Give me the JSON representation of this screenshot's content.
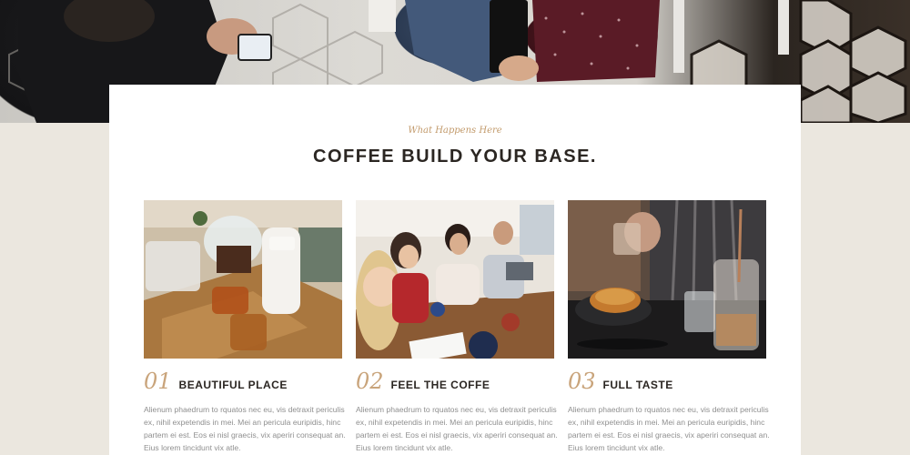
{
  "hero": {
    "image_icon": "cafe-people-photo"
  },
  "section": {
    "eyebrow": "What Happens Here",
    "title": "COFFEE BUILD YOUR BASE."
  },
  "features": [
    {
      "number": "01",
      "title": "BEAUTIFUL PLACE",
      "description": "Alienum phaedrum to rquatos nec eu, vis detraxit periculis ex, nihil expetendis in mei. Mei an pericula euripidis, hinc partem ei est. Eos ei nisl graecis, vix aperiri consequat an. Eius lorem tincidunt vix atle.",
      "image_icon": "coffee-brewing-photo"
    },
    {
      "number": "02",
      "title": "FEEL THE COFFE",
      "description": "Alienum phaedrum to rquatos nec eu, vis detraxit periculis ex, nihil expetendis in mei. Mei an pericula euripidis, hinc partem ei est. Eos ei nisl graecis, vix aperiri consequat an. Eius lorem tincidunt vix atle.",
      "image_icon": "friends-at-cafe-photo"
    },
    {
      "number": "03",
      "title": "FULL TASTE",
      "description": "Alienum phaedrum to rquatos nec eu, vis detraxit periculis ex, nihil expetendis in mei. Mei an pericula euripidis, hinc partem ei est. Eos ei nisl graecis, vix aperiri consequat an. Eius lorem tincidunt vix atle.",
      "image_icon": "croissant-coffee-photo"
    }
  ],
  "colors": {
    "accent": "#c9a47b",
    "background": "#ebe7df",
    "card": "#ffffff",
    "heading": "#2b2622",
    "body_text": "#8f8f8f"
  }
}
